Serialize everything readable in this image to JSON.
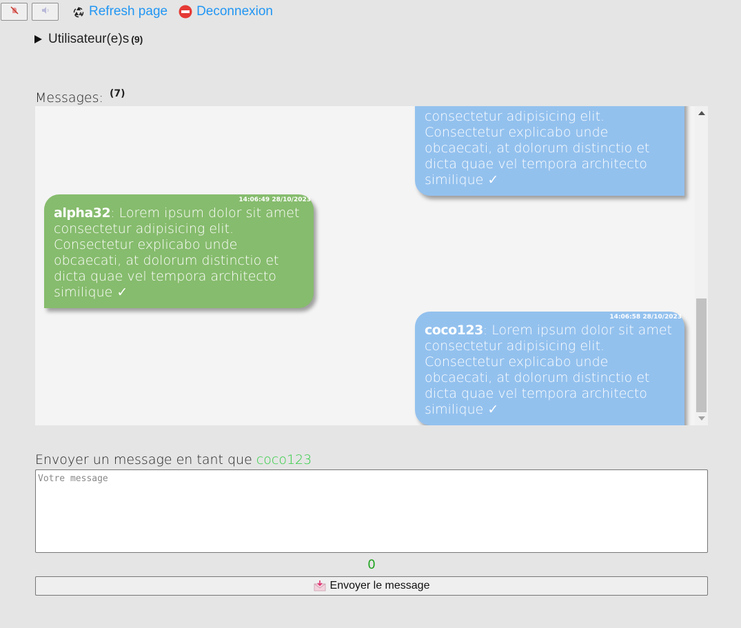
{
  "toolbar": {
    "mute_icon": "mute-notification-icon",
    "sound_icon": "speaker-icon",
    "refresh_icon": "recycle-icon",
    "refresh_label": "Refresh page",
    "logout_icon": "no-entry-icon",
    "logout_label": "Deconnexion"
  },
  "users": {
    "label": "Utilisateur(e)s",
    "count": "(9)"
  },
  "messages": {
    "label": "Messages:",
    "count": "(7)",
    "items": [
      {
        "author": "",
        "text": "consectetur adipisicing elit. Consectetur explicabo unde obcaecati, at dolorum distinctio et dicta quae vel tempora architecto similique ✓",
        "time": "",
        "side": "right"
      },
      {
        "author": "alpha32",
        "text": ": Lorem ipsum dolor sit amet consectetur adipisicing elit. Consectetur explicabo unde obcaecati, at dolorum distinctio et dicta quae vel tempora architecto similique ✓",
        "time": "14:06:49 28/10/2023",
        "side": "left"
      },
      {
        "author": "coco123",
        "text": ": Lorem ipsum dolor sit amet consectetur adipisicing elit. Consectetur explicabo unde obcaecati, at dolorum distinctio et dicta quae vel tempora architecto similique ✓",
        "time": "14:06:58 28/10/2023",
        "side": "right"
      }
    ]
  },
  "compose": {
    "label": "Envoyer un message en tant que",
    "username": "coco123",
    "placeholder": "Votre message",
    "value": "",
    "char_count": "0",
    "send_label": "Envoyer le message",
    "send_icon": "envelope-download-icon"
  },
  "colors": {
    "link": "#2196f3",
    "own_bubble": "#93c1ee",
    "other_bubble": "#86bc6d",
    "username": "#2ecc40",
    "counter": "#18a118"
  }
}
